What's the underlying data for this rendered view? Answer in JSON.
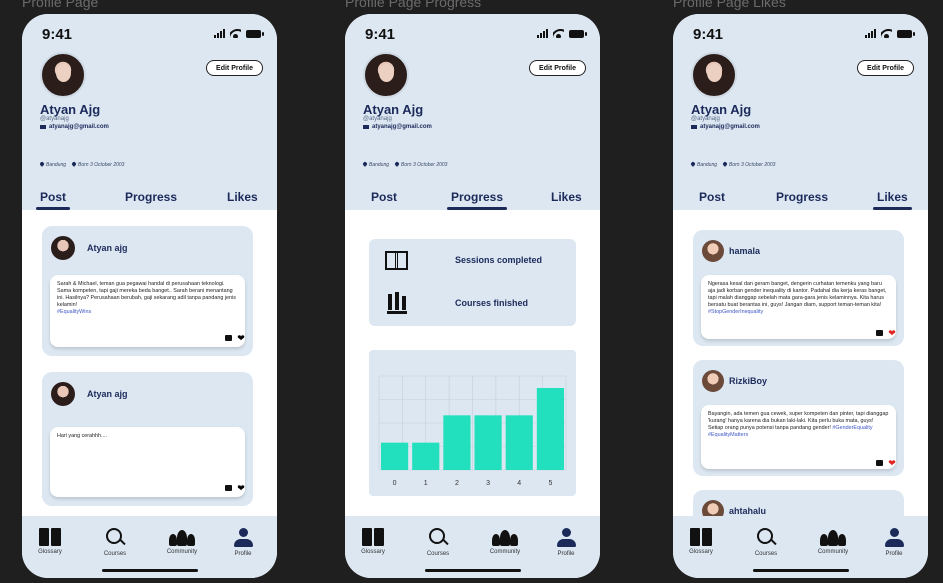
{
  "frames": [
    {
      "label": "Profile Page"
    },
    {
      "label": "Profile Page Progress"
    },
    {
      "label": "Profile Page Likes"
    }
  ],
  "status": {
    "time": "9:41"
  },
  "profile": {
    "name": "Atyan Ajg",
    "handle": "@atyanajg",
    "email": "atyanajg@gmail.com",
    "location": "Bandung",
    "birth": "Born 3 October 2003",
    "edit_label": "Edit Profile"
  },
  "tabs": [
    "Post",
    "Progress",
    "Likes"
  ],
  "posts": [
    {
      "user": "Atyan ajg",
      "text": "Sarah & Michael, teman gua pegawai handal di perusahaan teknologi. Sama kompeten, tapi gaji mereka beda banget.. Sarah berani menantang ini. Hasilnya? Perusahaan berubah, gaji sekarang adil tanpa pandang jenis kelamin!",
      "tag": "#EqualityWins"
    },
    {
      "user": "Atyan ajg",
      "text": "Hari yang cerahhh....",
      "tag": ""
    }
  ],
  "progress": {
    "sessions_label": "Sessions completed",
    "courses_label": "Courses finished"
  },
  "chart_data": {
    "type": "bar",
    "categories": [
      "0",
      "1",
      "2",
      "3",
      "4",
      "5"
    ],
    "values": [
      1,
      1,
      2,
      2,
      2,
      3
    ],
    "ylim": [
      0,
      3
    ],
    "grid": true,
    "color": "#22e0bd"
  },
  "likes": [
    {
      "user": "hamala",
      "text": "Ngerasa kesal dan geram banget, dengerin curhatan temenku yang baru aja jadi korban gender inequality di kantor. Padahal dia kerja keras banget, tapi malah dianggap sebelah mata gara-gara jenis kelaminnya. Kita harus bersatu buat berantas ini, guys! Jangan diam, support teman-teman kita!",
      "tag": "#StopGenderInequality"
    },
    {
      "user": "RizkiBoy",
      "text": "Bayangin, ada temen gua cewek, super kompeten dan pinter, tapi dianggap 'kurang' hanya karena dia bukan laki-laki. Kita perlu buka mata, guys! Setiap orang punya potensi tanpa pandang gender!",
      "tag": "#GenderEquality #EqualityMatters"
    },
    {
      "user": "ahtahalu",
      "text": "",
      "tag": ""
    }
  ],
  "nav": [
    "Glossary",
    "Courses",
    "Community",
    "Profile"
  ],
  "colors": {
    "header_bg": "#dce7f2",
    "primary_text": "#1c2a5a",
    "accent_bar": "#22e0bd",
    "background": "#1f1f1f"
  }
}
